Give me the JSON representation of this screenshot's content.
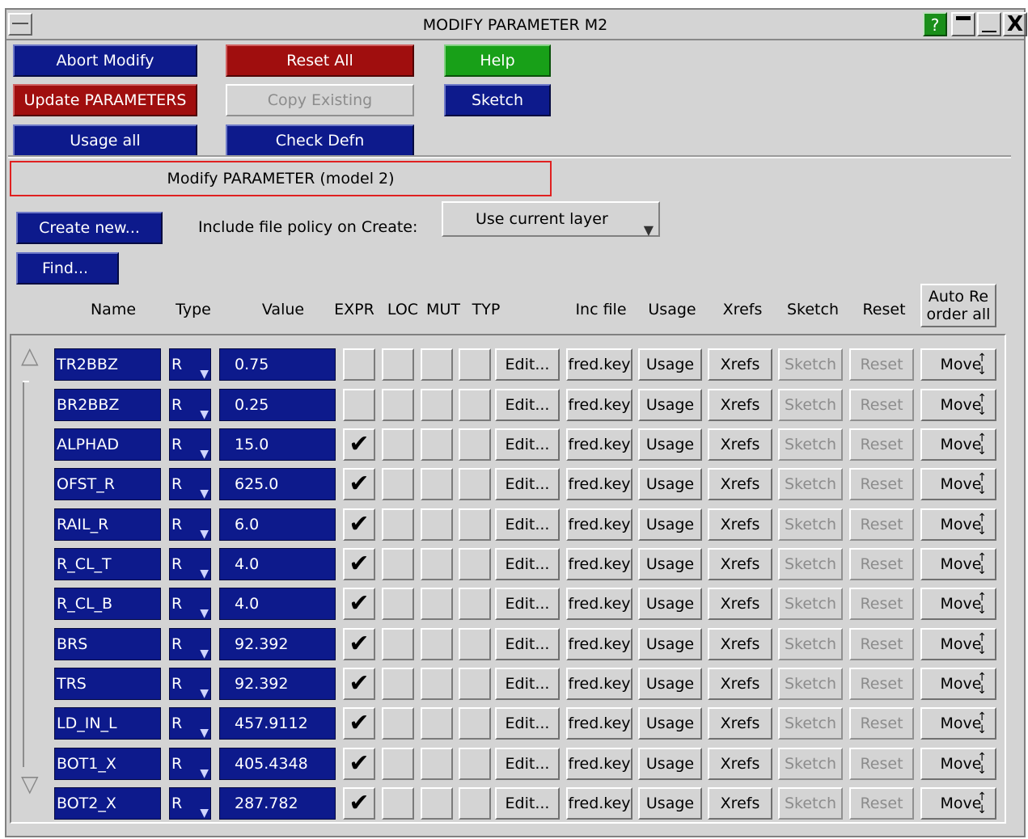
{
  "window": {
    "title": "MODIFY PARAMETER M2",
    "help_icon": "question-icon",
    "min_icon": "minimize-icon",
    "max_icon": "maximize-icon",
    "close_glyph": "X"
  },
  "toolbar": {
    "abort_modify": "Abort Modify",
    "reset_all": "Reset All",
    "help": "Help",
    "update_parameters": "Update PARAMETERS",
    "copy_existing": "Copy Existing",
    "sketch": "Sketch",
    "usage_all": "Usage all",
    "check_defn": "Check Defn"
  },
  "panel": {
    "heading": "Modify PARAMETER (model 2)",
    "create_new": "Create new...",
    "include_policy_label": "Include file policy on Create:",
    "include_policy_value": "Use current layer",
    "find": "Find..."
  },
  "columns": {
    "name": "Name",
    "type": "Type",
    "value": "Value",
    "expr": "EXPR",
    "loc": "LOC",
    "mut": "MUT",
    "typ": "TYP",
    "inc_file": "Inc file",
    "usage": "Usage",
    "xrefs": "Xrefs",
    "sketch": "Sketch",
    "reset": "Reset",
    "auto_reorder_line1": "Auto Re",
    "auto_reorder_line2": "order all"
  },
  "row_buttons": {
    "edit": "Edit...",
    "usage": "Usage",
    "xrefs": "Xrefs",
    "sketch": "Sketch",
    "reset": "Reset",
    "move": "Move"
  },
  "rows": [
    {
      "name": "TR2BBZ",
      "type": "R",
      "value": "0.75",
      "expr": false,
      "inc_file": "fred.key"
    },
    {
      "name": "BR2BBZ",
      "type": "R",
      "value": "0.25",
      "expr": false,
      "inc_file": "fred.key"
    },
    {
      "name": "ALPHAD",
      "type": "R",
      "value": "15.0",
      "expr": true,
      "inc_file": "fred.key"
    },
    {
      "name": "OFST_R",
      "type": "R",
      "value": "625.0",
      "expr": true,
      "inc_file": "fred.key"
    },
    {
      "name": "RAIL_R",
      "type": "R",
      "value": "6.0",
      "expr": true,
      "inc_file": "fred.key"
    },
    {
      "name": "R_CL_T",
      "type": "R",
      "value": "4.0",
      "expr": true,
      "inc_file": "fred.key"
    },
    {
      "name": "R_CL_B",
      "type": "R",
      "value": "4.0",
      "expr": true,
      "inc_file": "fred.key"
    },
    {
      "name": "BRS",
      "type": "R",
      "value": "92.392",
      "expr": true,
      "inc_file": "fred.key"
    },
    {
      "name": "TRS",
      "type": "R",
      "value": "92.392",
      "expr": true,
      "inc_file": "fred.key"
    },
    {
      "name": "LD_IN_L",
      "type": "R",
      "value": "457.9112",
      "expr": true,
      "inc_file": "fred.key"
    },
    {
      "name": "BOT1_X",
      "type": "R",
      "value": "405.4348",
      "expr": true,
      "inc_file": "fred.key"
    },
    {
      "name": "BOT2_X",
      "type": "R",
      "value": "287.782",
      "expr": true,
      "inc_file": "fred.key"
    }
  ]
}
